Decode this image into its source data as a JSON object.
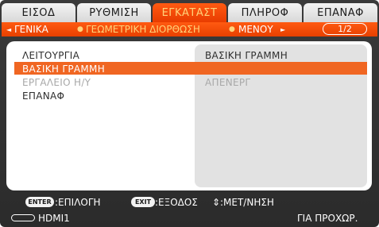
{
  "tabs": [
    {
      "label": "ΕΙΣΟΔ",
      "active": false
    },
    {
      "label": "ΡΥΘΜΙΣΗ",
      "active": false
    },
    {
      "label": "ΕΓΚΑΤΑΣΤ",
      "active": true
    },
    {
      "label": "ΠΛΗΡΟΦ",
      "active": false
    },
    {
      "label": "ΕΠΑΝΑΦ",
      "active": false
    }
  ],
  "subnav": {
    "left_arrow": "◄",
    "item1": "ΓΕΝΙΚΑ",
    "bullet": "●",
    "item2": "ΓΕΩΜΕΤΡΙΚΗ ΔΙΟΡΘΩΣΗ",
    "item3": "ΜΕΝΟΥ",
    "right_arrow": "►",
    "page": "1/2"
  },
  "rows": [
    {
      "label": "ΛΕΙΤΟΥΡΓΙΑ",
      "value": "ΒΑΣΙΚΗ ΓΡΑΜΜΗ"
    },
    {
      "label": "ΒΑΣΙΚΗ ΓΡΑΜΜΗ",
      "value": ""
    },
    {
      "label": "ΕΡΓΑΛΕΙΟ Η/Υ",
      "value": "ΑΠΕΝΕΡΓ"
    },
    {
      "label": "ΕΠΑΝΑΦ",
      "value": ""
    }
  ],
  "hints": {
    "enter_key": "ENTER",
    "enter_text": ":ΕΠΙΛΟΓΗ",
    "exit_key": "EXIT",
    "exit_text": ":ΕΞΟΔΟΣ",
    "move_symbol": "⇕",
    "move_text": ":ΜΕΤ/ΝΗΣΗ"
  },
  "status": {
    "input": "HDMI1",
    "right": "ΓΙΑ ΠΡΟΧΩΡ."
  },
  "colors": {
    "accent": "#f06622",
    "tab_active_text": "#ffd37a",
    "frame": "#333333"
  }
}
